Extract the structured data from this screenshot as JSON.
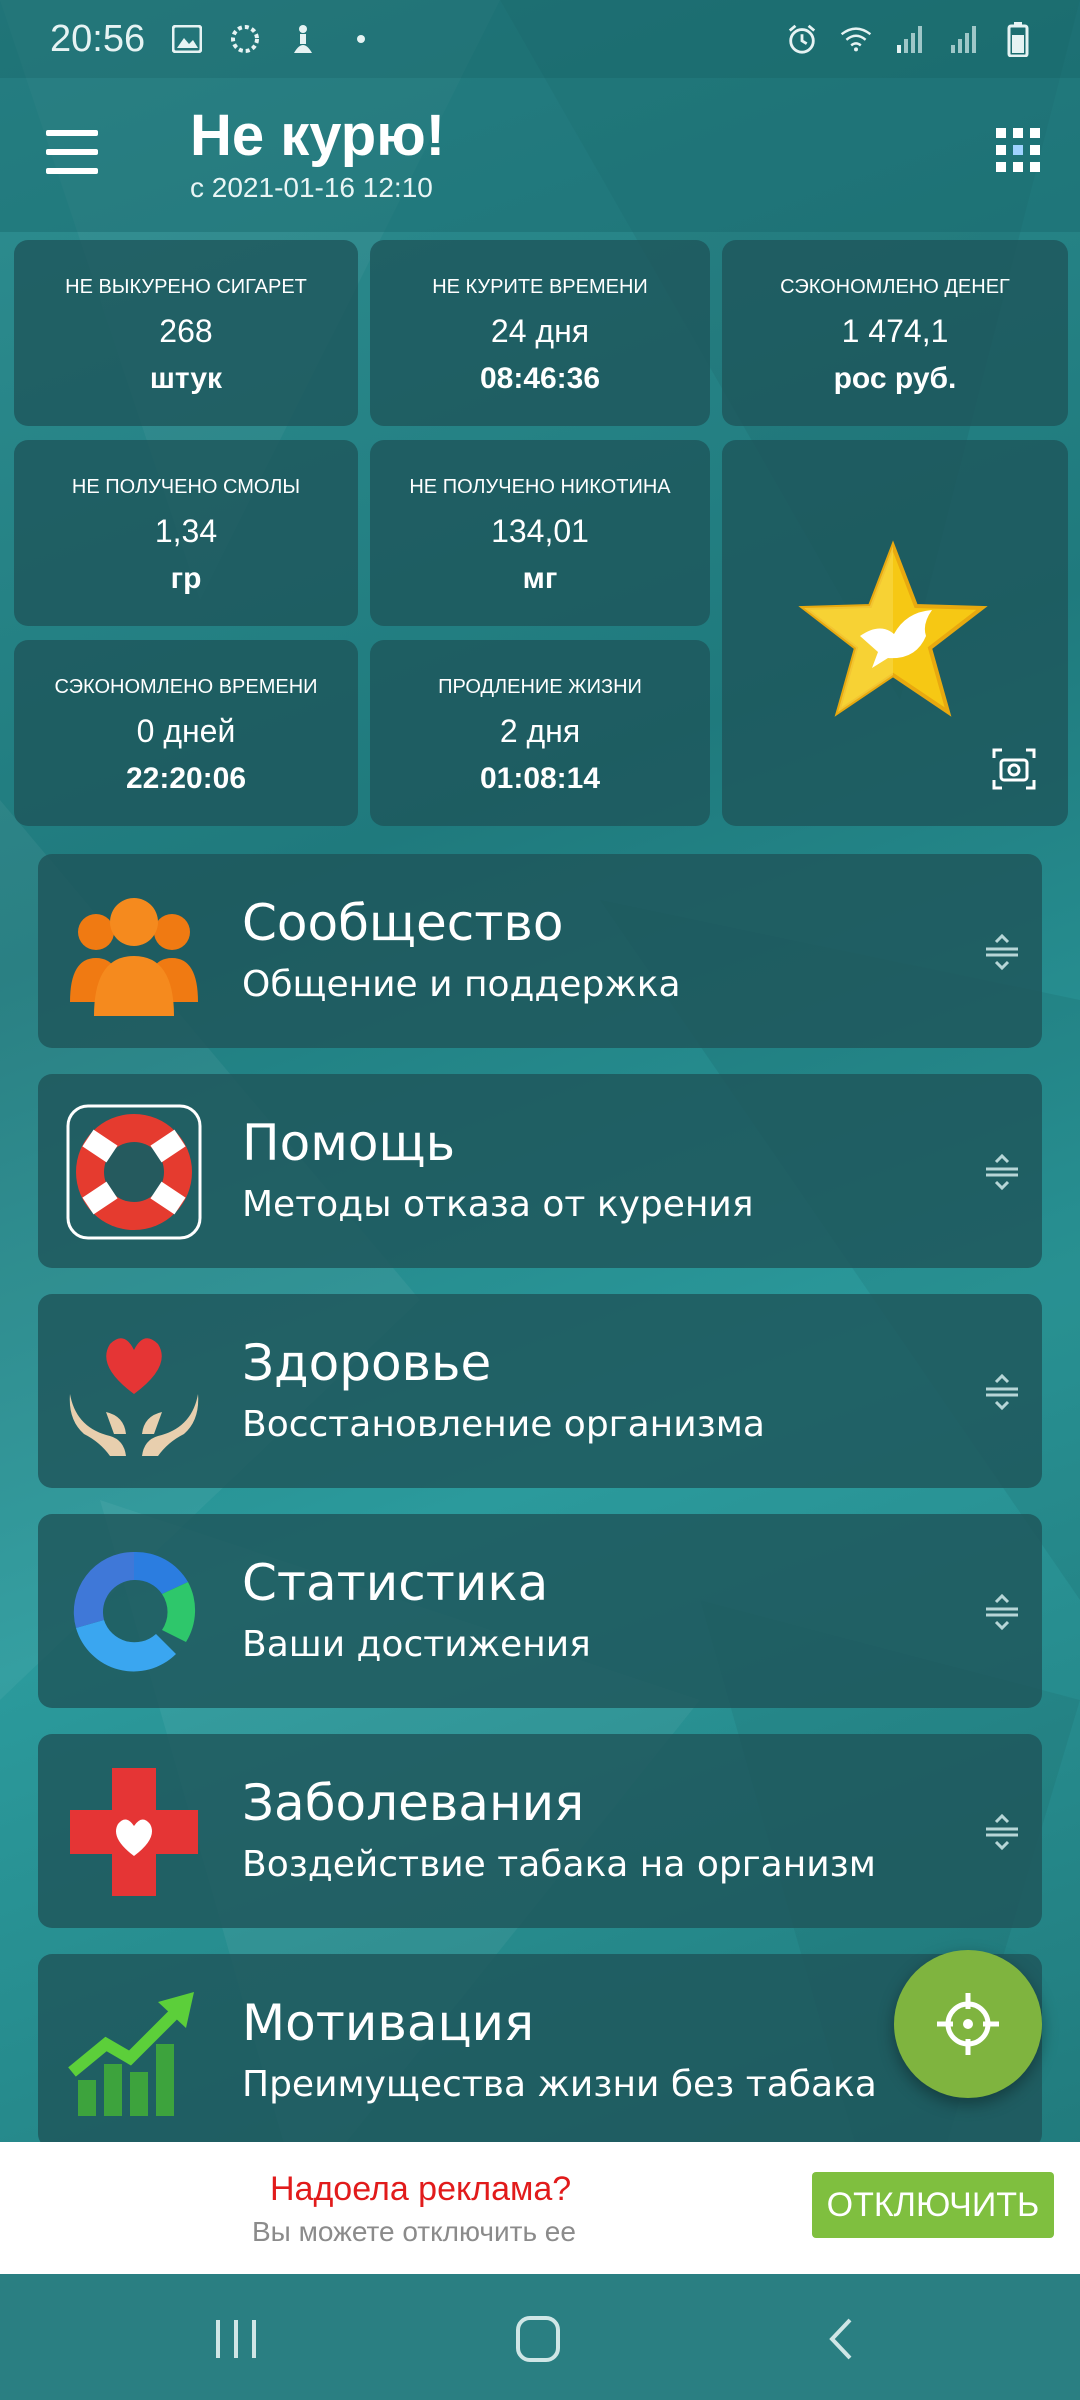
{
  "status_bar": {
    "time": "20:56",
    "icons_left": [
      "image-icon",
      "loading-circle-icon",
      "accessibility-icon",
      "dot-icon"
    ],
    "icons_right": [
      "alarm-icon",
      "wifi-icon",
      "signal-icon",
      "signal-icon",
      "battery-icon"
    ]
  },
  "app_bar": {
    "title": "Не курю!",
    "subtitle": "с 2021-01-16 12:10"
  },
  "stats": [
    {
      "label": "НЕ ВЫКУРЕНО СИГАРЕТ",
      "value": "268",
      "unit": "штук"
    },
    {
      "label": "НЕ КУРИТЕ ВРЕМЕНИ",
      "value": "24 дня",
      "unit": "08:46:36"
    },
    {
      "label": "СЭКОНОМЛЕНО ДЕНЕГ",
      "value": "1 474,1",
      "unit": "рос руб."
    },
    {
      "label": "НЕ ПОЛУЧЕНО СМОЛЫ",
      "value": "1,34",
      "unit": "гр"
    },
    {
      "label": "НЕ ПОЛУЧЕНО НИКОТИНА",
      "value": "134,01",
      "unit": "мг"
    },
    {
      "label": "СЭКОНОМЛЕНО ВРЕМЕНИ",
      "value": "0 дней",
      "unit": "22:20:06"
    },
    {
      "label": "ПРОДЛЕНИЕ ЖИЗНИ",
      "value": "2 дня",
      "unit": "01:08:14"
    }
  ],
  "menu": [
    {
      "title": "Сообщество",
      "subtitle": "Общение и поддержка",
      "icon": "community-people-icon"
    },
    {
      "title": "Помощь",
      "subtitle": "Методы отказа от курения",
      "icon": "lifebuoy-icon"
    },
    {
      "title": "Здоровье",
      "subtitle": "Восстановление организма",
      "icon": "heart-hands-icon"
    },
    {
      "title": "Статистика",
      "subtitle": "Ваши достижения",
      "icon": "ring-chart-icon"
    },
    {
      "title": "Заболевания",
      "subtitle": "Воздействие табака на организм",
      "icon": "medical-cross-icon"
    },
    {
      "title": "Мотивация",
      "subtitle": "Преимущества жизни без табака",
      "icon": "growth-chart-icon"
    }
  ],
  "ad": {
    "title": "Надоела реклама?",
    "subtitle": "Вы можете отключить ее",
    "button": "ОТКЛЮЧИТЬ"
  },
  "colors": {
    "accent_green": "#7fb43f",
    "ad_red": "#e11b1b",
    "tile_bg": "#1e555a"
  }
}
